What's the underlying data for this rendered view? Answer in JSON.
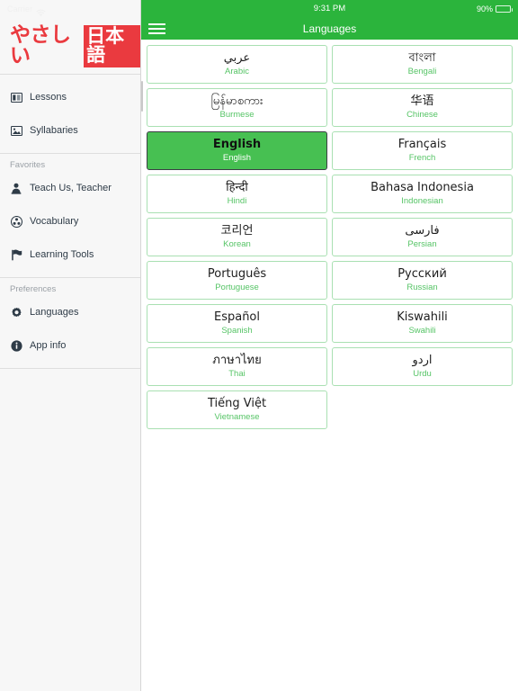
{
  "status_bar": {
    "carrier": "Carrier",
    "wifi_icon": "wifi-icon",
    "time": "9:31 PM",
    "battery_percent": "90%",
    "battery_icon": "battery-icon"
  },
  "sidebar": {
    "logo": {
      "kana": "やさしい",
      "kanji": "日本語"
    },
    "groups": [
      {
        "header": null,
        "items": [
          {
            "label": "Lessons",
            "icon": "lessons-icon"
          },
          {
            "label": "Syllabaries",
            "icon": "syllabaries-icon"
          }
        ]
      },
      {
        "header": "Favorites",
        "items": [
          {
            "label": "Teach Us, Teacher",
            "icon": "person-icon"
          },
          {
            "label": "Vocabulary",
            "icon": "vocabulary-icon"
          },
          {
            "label": "Learning Tools",
            "icon": "flag-icon"
          }
        ]
      },
      {
        "header": "Preferences",
        "items": [
          {
            "label": "Languages",
            "icon": "gear-icon"
          },
          {
            "label": "App info",
            "icon": "info-icon"
          }
        ]
      }
    ]
  },
  "navbar": {
    "menu_icon": "hamburger-menu-icon",
    "title": "Languages"
  },
  "languages": [
    {
      "native": "عربي",
      "english": "Arabic",
      "selected": false
    },
    {
      "native": "বাংলা",
      "english": "Bengali",
      "selected": false
    },
    {
      "native": "မြန်မာစကား",
      "english": "Burmese",
      "selected": false
    },
    {
      "native": "华语",
      "english": "Chinese",
      "selected": false
    },
    {
      "native": "English",
      "english": "English",
      "selected": true
    },
    {
      "native": "Français",
      "english": "French",
      "selected": false
    },
    {
      "native": "हिन्दी",
      "english": "Hindi",
      "selected": false
    },
    {
      "native": "Bahasa Indonesia",
      "english": "Indonesian",
      "selected": false
    },
    {
      "native": "코리언",
      "english": "Korean",
      "selected": false
    },
    {
      "native": "فارسی",
      "english": "Persian",
      "selected": false
    },
    {
      "native": "Português",
      "english": "Portuguese",
      "selected": false
    },
    {
      "native": "Русский",
      "english": "Russian",
      "selected": false
    },
    {
      "native": "Español",
      "english": "Spanish",
      "selected": false
    },
    {
      "native": "Kiswahili",
      "english": "Swahili",
      "selected": false
    },
    {
      "native": "ภาษาไทย",
      "english": "Thai",
      "selected": false
    },
    {
      "native": "اردو",
      "english": "Urdu",
      "selected": false
    },
    {
      "native": "Tiếng Việt",
      "english": "Vietnamese",
      "selected": false
    }
  ],
  "colors": {
    "brand_green": "#2bb43c",
    "selected_green": "#47c052",
    "cell_border": "#a9e0b2",
    "cell_label_green": "#56c466",
    "logo_red": "#ea3a3f",
    "sidebar_bg": "#f7f7f7",
    "sidebar_text": "#2e3b47",
    "section_header": "#9aa0a6"
  }
}
